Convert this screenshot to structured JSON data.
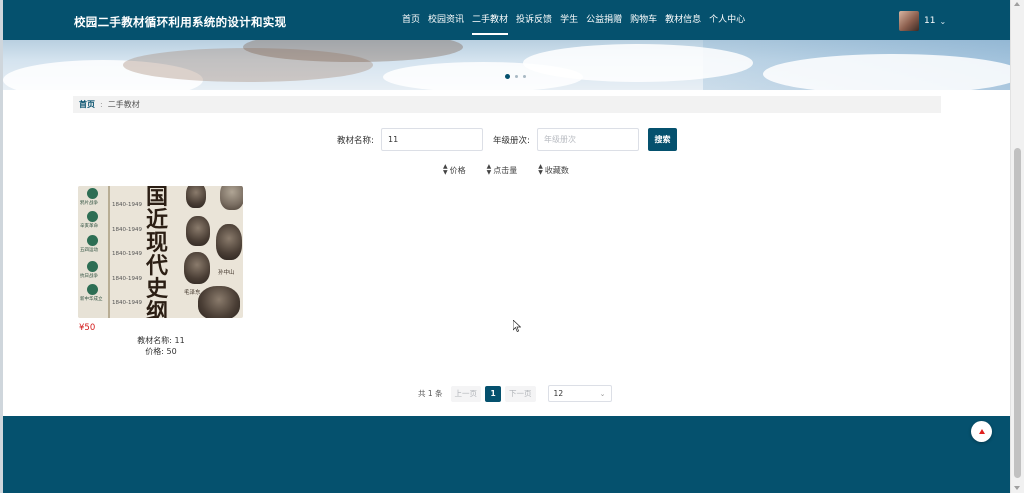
{
  "header": {
    "site_title": "校园二手教材循环利用系统的设计和实现",
    "nav": [
      {
        "label": "首页",
        "active": false
      },
      {
        "label": "校园资讯",
        "active": false
      },
      {
        "label": "二手教材",
        "active": true
      },
      {
        "label": "投诉反馈",
        "active": false
      },
      {
        "label": "学生",
        "active": false
      },
      {
        "label": "公益捐赠",
        "active": false
      },
      {
        "label": "购物车",
        "active": false
      },
      {
        "label": "教材信息",
        "active": false
      },
      {
        "label": "个人中心",
        "active": false
      }
    ],
    "user": {
      "name": "11",
      "avatar_icon": "user-avatar",
      "dropdown_icon": "chevron-down-icon"
    }
  },
  "banner": {
    "slides": 3,
    "active_slide": 0
  },
  "breadcrumb": {
    "home": "首页",
    "separator": ":",
    "current": "二手教材"
  },
  "search": {
    "name_label": "教材名称:",
    "name_value": "11",
    "grade_label": "年级册次:",
    "grade_placeholder": "年级册次",
    "button": "搜索"
  },
  "sort": [
    {
      "label": "价格",
      "icon": "sort-icon"
    },
    {
      "label": "点击量",
      "icon": "sort-icon"
    },
    {
      "label": "收藏数",
      "icon": "sort-icon"
    }
  ],
  "products": [
    {
      "cover": {
        "title_chars": "国近现代史纲要",
        "timeline": [
          {
            "label": "鸦片战争",
            "year": "1840-1949"
          },
          {
            "label": "辛亥革命",
            "year": "1840-1949"
          },
          {
            "label": "五四运动",
            "year": "1840-1949"
          },
          {
            "label": "抗日战争",
            "year": "1840-1949"
          },
          {
            "label": "新中华成立",
            "year": "1840-1949"
          }
        ],
        "captions": [
          "孙中山",
          "毛泽东"
        ]
      },
      "price": "¥50",
      "name_line": "教材名称: 11",
      "price_line": "价格: 50"
    }
  ],
  "pagination": {
    "total": "共 1 条",
    "prev": "上一页",
    "current": "1",
    "next": "下一页",
    "page_size": "12"
  },
  "colors": {
    "primary": "#05516e",
    "price": "#d31b1b",
    "back_to_top_arrow": "#e0201e"
  }
}
